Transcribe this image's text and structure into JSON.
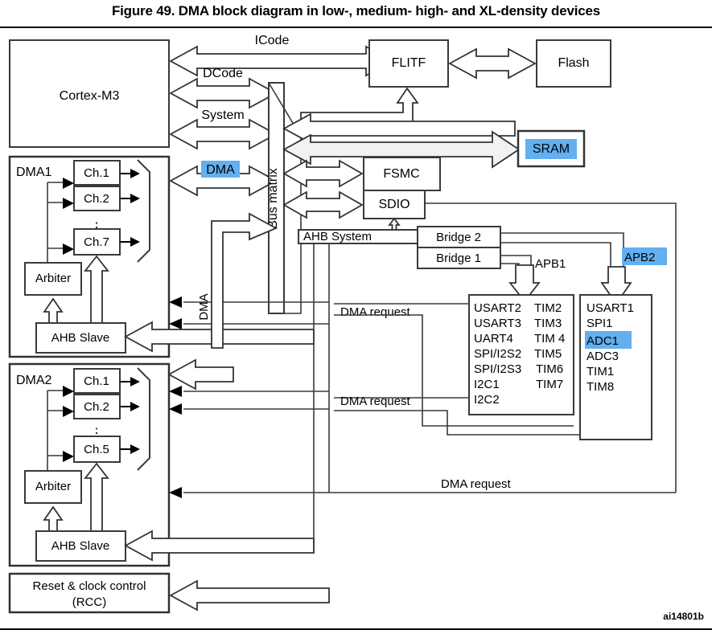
{
  "figure": {
    "title": "Figure 49. DMA block diagram in low-, medium- high- and XL-density devices",
    "id_code": "ai14801b"
  },
  "colors": {
    "highlight": "#62b0f0",
    "line": "#3a3a3a",
    "background": "#ffffff"
  },
  "blocks": {
    "cortex": "Cortex-M3",
    "flitf": "FLITF",
    "flash": "Flash",
    "sram": "SRAM",
    "fsmc": "FSMC",
    "sdio": "SDIO",
    "bus_matrix": "Bus matrix",
    "bridge2": "Bridge  2",
    "bridge1": "Bridge  1",
    "rcc_line1": "Reset & clock control",
    "rcc_line2": "(RCC)"
  },
  "bus_labels": {
    "icode": "ICode",
    "dcode": "DCode",
    "system": "System",
    "dma": "DMA",
    "dma_vertical": "DMA",
    "ahb_system": "AHB System",
    "apb1": "APB1",
    "apb2": "APB2",
    "dma_request_1": "DMA request",
    "dma_request_2": "DMA request",
    "dma_request_3": "DMA request"
  },
  "dma1": {
    "title": "DMA1",
    "channels": [
      "Ch.1",
      "Ch.2",
      "Ch.7"
    ],
    "ellipsis": "⋮",
    "arbiter": "Arbiter",
    "ahb_slave": "AHB Slave"
  },
  "dma2": {
    "title": "DMA2",
    "channels": [
      "Ch.1",
      "Ch.2",
      "Ch.5"
    ],
    "ellipsis": "⋮",
    "arbiter": "Arbiter",
    "ahb_slave": "AHB Slave"
  },
  "apb1_peripherals": {
    "column1": [
      "USART2",
      "USART3",
      "UART4",
      "SPI/I2S2",
      "SPI/I2S3",
      "I2C1",
      "I2C2"
    ],
    "column2": [
      "TIM2",
      "TIM3",
      "TIM 4",
      "TIM5",
      "TIM6",
      "TIM7"
    ]
  },
  "apb2_peripherals": {
    "column1": [
      "USART1",
      "SPI1",
      "ADC1",
      "ADC3",
      "TIM1",
      "TIM8"
    ]
  },
  "highlighted_items": [
    "DMA",
    "SRAM",
    "APB2",
    "ADC1"
  ]
}
